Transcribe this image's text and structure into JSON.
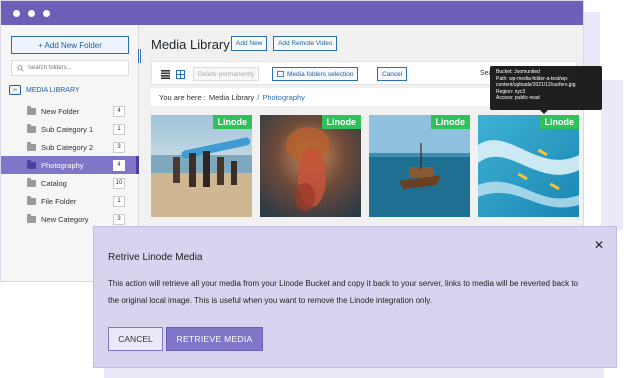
{
  "sidebar": {
    "new_folder_label": "+ Add New Folder",
    "search_placeholder": "Search folders...",
    "library_label": "MEDIA LIBRARY",
    "folders": [
      {
        "name": "New Folder",
        "count": "4"
      },
      {
        "name": "Sub Category 1",
        "count": "1"
      },
      {
        "name": "Sub Category 2",
        "count": "3"
      },
      {
        "name": "Photography",
        "count": "4",
        "active": true
      },
      {
        "name": "Catalog",
        "count": "10"
      },
      {
        "name": "File Folder",
        "count": "1"
      },
      {
        "name": "New Category",
        "count": "3"
      }
    ]
  },
  "header": {
    "title": "Media Library",
    "add_new_label": "Add New",
    "add_remote_label": "Add Remote Video"
  },
  "toolbar": {
    "delete_label": "Delete permanently",
    "folders_selection_label": "Media folders selection",
    "cancel_label": "Cancel",
    "search_label": "Search"
  },
  "breadcrumb": {
    "prefix": "You are here :",
    "root": "Media Library",
    "separator": "/",
    "current": "Photography"
  },
  "media": [
    {
      "badge": "Linode",
      "subject": "surfers-beach"
    },
    {
      "badge": "Linode",
      "subject": "underwater-woman"
    },
    {
      "badge": "Linode",
      "subject": "boat-sea"
    },
    {
      "badge": "Linode",
      "subject": "surfers-wave"
    }
  ],
  "tooltip": {
    "bucket": "Bucket: Joomunited",
    "path_1": "Path: wp-media-folder-a-test/wp-",
    "path_2": "content/uploads/2021/12/surfers.jpg",
    "region": "Region: nyc3",
    "access": "Access: public-read"
  },
  "modal": {
    "close_symbol": "✕",
    "title": "Retrive Linode Media",
    "body": "This action will retrieve all your media from your Linode Bucket and copy it back to your server, links to media will be reverted back to the original local image. This is useful when you want to remove the Linode integration only.",
    "cancel_label": "CANCEL",
    "retrieve_label": "RETRIEVE MEDIA"
  },
  "colors": {
    "brand": "#6d5fb8",
    "active_folder": "#7f76c7",
    "badge": "#2fc25b",
    "link": "#2a6fb5"
  }
}
